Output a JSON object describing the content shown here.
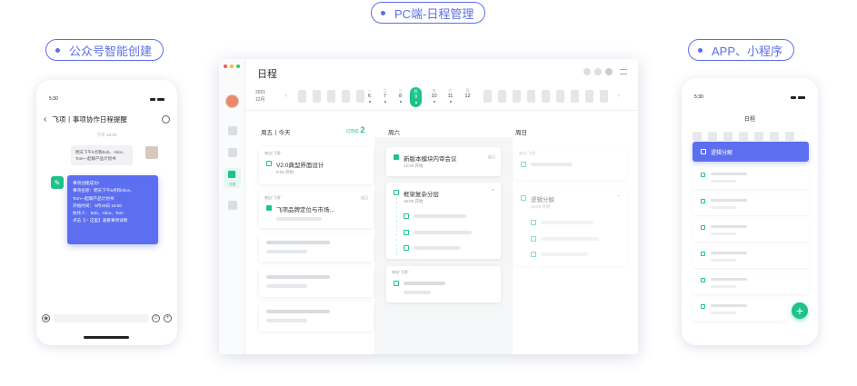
{
  "labels": {
    "pc": "PC端-日程管理",
    "wechat": "公众号智能创建",
    "app": "APP、小程序"
  },
  "colors": {
    "accent": "#5c6ff0",
    "green": "#1ec28b"
  },
  "left_phone": {
    "time": "5:30",
    "chat_title": "飞项丨事项协作日程提醒",
    "chat_time": "下午 18:00",
    "sent_lines": [
      "明天下午5点和Bob、Alice、",
      "Tom一起聊产品计划书"
    ],
    "card": {
      "title": "事项创建成功!",
      "name_label": "事项名称：明天下午5点和Alice、",
      "name_cont": "Tom一起聊产品计划书",
      "start": "开始时间： 9月29日 18:00",
      "people": "协作人： Bob、Alice、Tom",
      "action": "点击【✓ 这里】查看事项详情"
    }
  },
  "desktop": {
    "title": "日程",
    "year": "2021",
    "month": "12月",
    "strip": [
      {
        "w": "一",
        "d": "6"
      },
      {
        "w": "二",
        "d": "7"
      },
      {
        "w": "三",
        "d": "8"
      },
      {
        "w": "四",
        "d": "9",
        "today": true
      },
      {
        "w": "五",
        "d": "10"
      },
      {
        "w": "六",
        "d": "11"
      },
      {
        "w": "日",
        "d": "12"
      }
    ],
    "side_active_label": "日程",
    "columns": {
      "fri": "周五丨今天",
      "sat": "周六",
      "sun": "周日"
    },
    "done_label": "已完成",
    "done_count": "2",
    "fri_cards": [
      {
        "src": "来自“飞项”",
        "text": "V2.0典型界面设计",
        "time": "9:00 开始"
      },
      {
        "src": "来自“飞项”",
        "tag": "自己",
        "text": "飞项品牌定位与市场..."
      }
    ],
    "sat_cards": [
      {
        "text": "新版本模块内审会议",
        "time": "12:00 开始",
        "tag": "自己"
      },
      {
        "text": "框架复杂分层",
        "time": "16:00 开始"
      },
      {
        "src": "来自“飞项”"
      }
    ],
    "sun_cards": [
      {
        "src": "来自“飞项”"
      },
      {
        "text": "逻辑分解",
        "time": "16:00 开始"
      }
    ]
  },
  "right_phone": {
    "time": "5:30",
    "title": "日程",
    "selected_task": "逻辑分解",
    "fab": "+"
  }
}
